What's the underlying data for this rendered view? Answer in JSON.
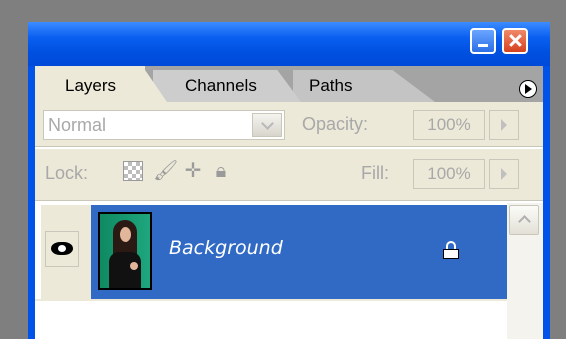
{
  "window": {
    "buttons": {
      "minimize_icon": "minimize-icon",
      "close_icon": "close-icon"
    }
  },
  "tabs": [
    {
      "label": "Layers",
      "active": true
    },
    {
      "label": "Channels",
      "active": false
    },
    {
      "label": "Paths",
      "active": false
    }
  ],
  "options": {
    "blend_mode": "Normal",
    "opacity_label": "Opacity:",
    "opacity_value": "100%",
    "lock_label": "Lock:",
    "fill_label": "Fill:",
    "fill_value": "100%"
  },
  "layers": [
    {
      "name": "Background",
      "visible": true,
      "locked": true,
      "selected": true
    }
  ],
  "colors": {
    "selection": "#316ac5",
    "titlebar": "#0050e0",
    "panel": "#ece9d8"
  }
}
